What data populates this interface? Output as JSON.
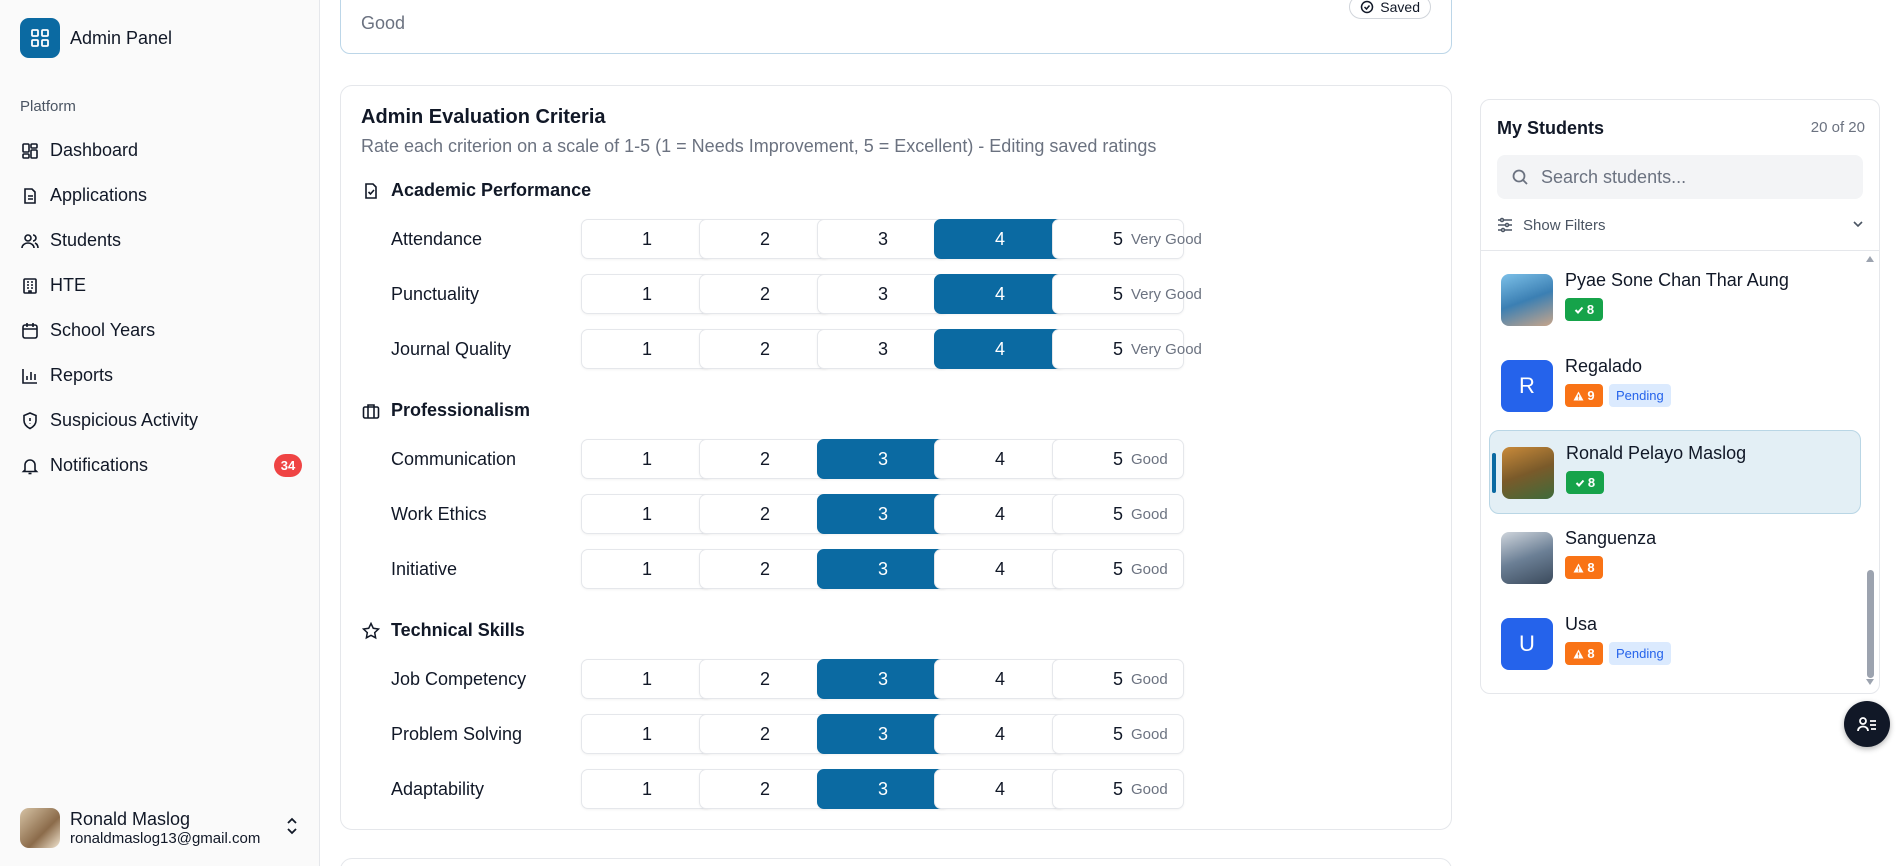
{
  "sidebar": {
    "brand": "Admin Panel",
    "group_label": "Platform",
    "items": [
      {
        "label": "Dashboard",
        "icon": "dashboard-icon"
      },
      {
        "label": "Applications",
        "icon": "document-icon"
      },
      {
        "label": "Students",
        "icon": "users-icon"
      },
      {
        "label": "HTE",
        "icon": "building-icon"
      },
      {
        "label": "School Years",
        "icon": "calendar-icon"
      },
      {
        "label": "Reports",
        "icon": "bar-chart-icon"
      },
      {
        "label": "Suspicious Activity",
        "icon": "shield-icon"
      },
      {
        "label": "Notifications",
        "icon": "bell-icon",
        "badge": "34"
      }
    ],
    "user": {
      "name": "Ronald Maslog",
      "email": "ronaldmaslog13@gmail.com"
    }
  },
  "top_card": {
    "rating_word": "Good",
    "saved_label": "Saved"
  },
  "evaluation": {
    "title": "Admin Evaluation Criteria",
    "subtitle": "Rate each criterion on a scale of 1-5 (1 = Needs Improvement, 5 = Excellent) - Editing saved ratings",
    "scale": [
      "1",
      "2",
      "3",
      "4",
      "5"
    ],
    "sections": [
      {
        "title": "Academic Performance",
        "icon": "file-check-icon",
        "criteria": [
          {
            "label": "Attendance",
            "selected": 4,
            "word": "Very Good"
          },
          {
            "label": "Punctuality",
            "selected": 4,
            "word": "Very Good"
          },
          {
            "label": "Journal Quality",
            "selected": 4,
            "word": "Very Good"
          }
        ]
      },
      {
        "title": "Professionalism",
        "icon": "briefcase-icon",
        "criteria": [
          {
            "label": "Communication",
            "selected": 3,
            "word": "Good"
          },
          {
            "label": "Work Ethics",
            "selected": 3,
            "word": "Good"
          },
          {
            "label": "Initiative",
            "selected": 3,
            "word": "Good"
          }
        ]
      },
      {
        "title": "Technical Skills",
        "icon": "star-icon",
        "criteria": [
          {
            "label": "Job Competency",
            "selected": 3,
            "word": "Good"
          },
          {
            "label": "Problem Solving",
            "selected": 3,
            "word": "Good"
          },
          {
            "label": "Adaptability",
            "selected": 3,
            "word": "Good"
          }
        ]
      }
    ]
  },
  "students_panel": {
    "title": "My Students",
    "count": "20 of 20",
    "search_placeholder": "Search students...",
    "filters_label": "Show Filters",
    "students": [
      {
        "name": "Pyae Sone Chan Thar Aung",
        "avatar": "photo",
        "score": "8",
        "status": "ok",
        "pending": ""
      },
      {
        "name": "Regalado",
        "avatar": "R",
        "score": "9",
        "status": "warn",
        "pending": "Pending"
      },
      {
        "name": "Ronald Pelayo Maslog",
        "avatar": "photo",
        "score": "8",
        "status": "ok",
        "pending": "",
        "active": true
      },
      {
        "name": "Sanguenza",
        "avatar": "photo",
        "score": "8",
        "status": "warn",
        "pending": ""
      },
      {
        "name": "Usa",
        "avatar": "U",
        "score": "8",
        "status": "warn",
        "pending": "Pending"
      }
    ]
  },
  "colors": {
    "primary": "#0b6aa2",
    "danger": "#ef4444",
    "success": "#16a34a",
    "warning": "#f97316"
  }
}
